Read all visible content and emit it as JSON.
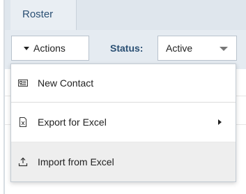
{
  "tab": {
    "label": "Roster"
  },
  "toolbar": {
    "actions_label": "Actions",
    "status_label": "Status:",
    "status_value": "Active"
  },
  "menu": {
    "items": [
      {
        "label": "New Contact",
        "icon": "contact-card-icon",
        "has_submenu": false,
        "highlighted": false
      },
      {
        "label": "Export for Excel",
        "icon": "excel-file-icon",
        "has_submenu": true,
        "highlighted": false
      },
      {
        "label": "Import from Excel",
        "icon": "upload-icon",
        "has_submenu": false,
        "highlighted": true
      }
    ]
  },
  "colors": {
    "accent_text": "#2a4f73",
    "toolbar_bg": "#e5ebf1",
    "highlight_bg": "#eeeeee"
  }
}
